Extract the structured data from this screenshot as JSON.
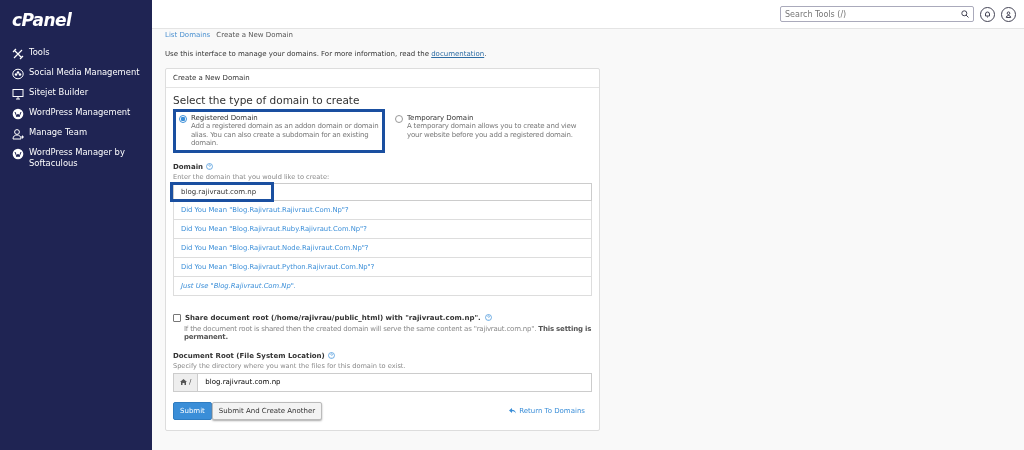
{
  "sidebar": {
    "logo": "cPanel",
    "items": [
      {
        "label": "Tools"
      },
      {
        "label": "Social Media Management"
      },
      {
        "label": "Sitejet Builder"
      },
      {
        "label": "WordPress Management"
      },
      {
        "label": "Manage Team"
      },
      {
        "label": "WordPress Manager by Softaculous"
      }
    ]
  },
  "header": {
    "search": {
      "placeholder": "Search Tools (/)"
    }
  },
  "breadcrumb": [
    {
      "label": "List Domains",
      "kind": "link"
    },
    {
      "label": "Create a New Domain",
      "kind": "current"
    }
  ],
  "intro": {
    "text": "Use this interface to manage your domains. For more information, read the ",
    "link": "documentation",
    "end": "."
  },
  "card": {
    "title": "Create a New Domain",
    "heading": "Select the type of domain to create",
    "domain_types": [
      {
        "label": "Registered Domain",
        "description": "Add a registered domain as an addon domain or domain alias. You can also create a subdomain for an existing domain.",
        "selected": true,
        "highlighted": true
      },
      {
        "label": "Temporary Domain",
        "description": "A temporary domain allows you to create and view your website before you add a registered domain.",
        "selected": false,
        "highlighted": false
      }
    ],
    "domain": {
      "label": "Domain",
      "hint": "Enter the domain that you would like to create:",
      "value": "blog.rajivraut.com.np",
      "highlighted": true,
      "suggestions": [
        {
          "text": "Did You Mean \"Blog.Rajivraut.Rajivraut.Com.Np\"?",
          "kind": "suggest"
        },
        {
          "text": "Did You Mean \"Blog.Rajivraut.Ruby.Rajivraut.Com.Np\"?",
          "kind": "suggest"
        },
        {
          "text": "Did You Mean \"Blog.Rajivraut.Node.Rajivraut.Com.Np\"?",
          "kind": "suggest"
        },
        {
          "text": "Did You Mean \"Blog.Rajivraut.Python.Rajivraut.Com.Np\"?",
          "kind": "suggest"
        },
        {
          "text": "Just Use \"Blog.Rajivraut.Com.Np\".",
          "kind": "use"
        }
      ]
    },
    "share": {
      "label": "Share document root (/home/rajivrau/public_html) with \"rajivraut.com.np\".",
      "checked": false,
      "note": "If the document root is shared then the created domain will serve the same content as \"rajivraut.com.np\". **This setting is permanent.**"
    },
    "docroot": {
      "label": "Document Root (File System Location)",
      "hint": "Specify the directory where you want the files for this domain to exist.",
      "prefix": "/",
      "value": "blog.rajivraut.com.np"
    },
    "buttons": [
      {
        "label": "Submit",
        "kind": "primary"
      },
      {
        "label": "Submit And Create Another",
        "kind": "secondary"
      }
    ],
    "return_link": "Return To Domains"
  }
}
